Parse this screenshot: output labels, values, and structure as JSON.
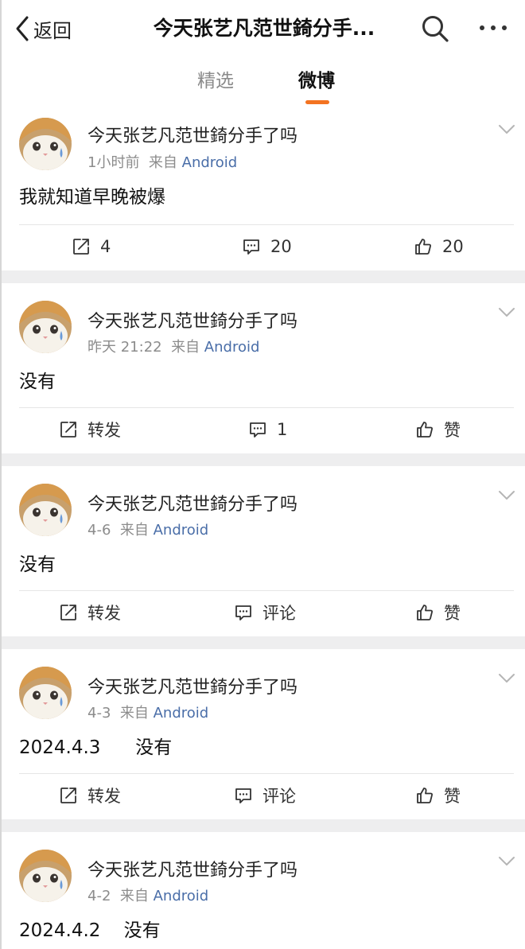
{
  "nav": {
    "back_label": "返回",
    "title": "今天张艺凡范世錡分手...",
    "back_icon": "chevron-left-icon",
    "search_icon": "search-icon",
    "more_icon": "more-dots-icon"
  },
  "tabs": [
    {
      "label": "精选",
      "active": false
    },
    {
      "label": "微博",
      "active": true
    }
  ],
  "accent_color": "#f37321",
  "link_color": "#4a6ea8",
  "posts": [
    {
      "username": "今天张艺凡范世錡分手了吗",
      "time": "1小时前",
      "source_prefix": "来自",
      "source": "Android",
      "text": "我就知道早晚被爆",
      "repost": "4",
      "comment": "20",
      "like": "20"
    },
    {
      "username": "今天张艺凡范世錡分手了吗",
      "time": "昨天 21:22",
      "source_prefix": "来自",
      "source": "Android",
      "text": "没有",
      "repost": "转发",
      "comment": "1",
      "like": "赞"
    },
    {
      "username": "今天张艺凡范世錡分手了吗",
      "time": "4-6",
      "source_prefix": "来自",
      "source": "Android",
      "text": "没有",
      "repost": "转发",
      "comment": "评论",
      "like": "赞"
    },
    {
      "username": "今天张艺凡范世錡分手了吗",
      "time": "4-3",
      "source_prefix": "来自",
      "source": "Android",
      "text": "2024.4.3      没有",
      "repost": "转发",
      "comment": "评论",
      "like": "赞"
    },
    {
      "username": "今天张艺凡范世錡分手了吗",
      "time": "4-2",
      "source_prefix": "来自",
      "source": "Android",
      "text": "2024.4.2    没有"
    }
  ]
}
